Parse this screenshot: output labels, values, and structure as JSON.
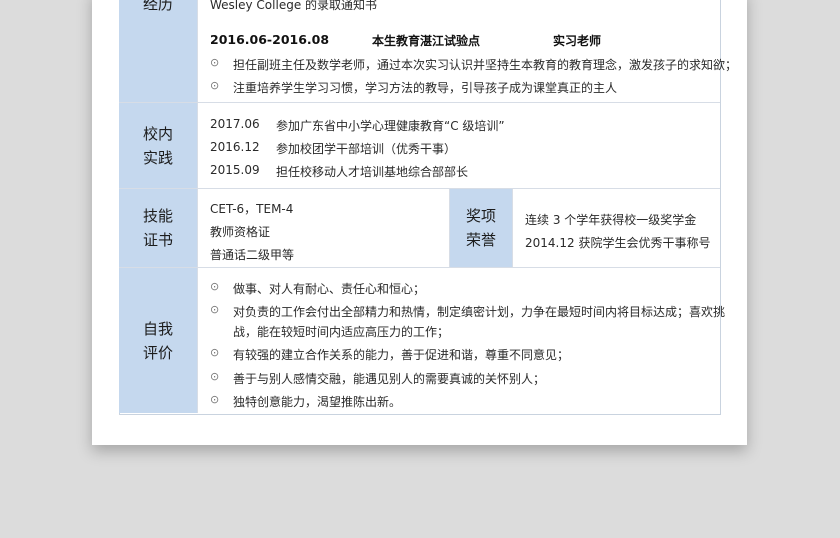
{
  "experience": {
    "label": "经历",
    "partial_line": "Wesley College 的录取通知书",
    "period": "2016.06-2016.08",
    "org": "本生教育湛江试验点",
    "role": "实习老师",
    "bullets": [
      "担任副班主任及数学老师，通过本次实习认识并坚持生本教育的教育理念，激发孩子的求知欲；",
      "注重培养学生学习习惯，学习方法的教导，引导孩子成为课堂真正的主人"
    ]
  },
  "campus": {
    "label_1": "校内",
    "label_2": "实践",
    "items": [
      {
        "date": "2017.06",
        "desc": "参加广东省中小学心理健康教育“C 级培训”"
      },
      {
        "date": "2016.12",
        "desc": "参加校团学干部培训（优秀干事）"
      },
      {
        "date": "2015.09",
        "desc": "担任校移动人才培训基地综合部部长"
      }
    ]
  },
  "skills": {
    "label_1": "技能",
    "label_2": "证书",
    "items": [
      "CET-6，TEM-4",
      "教师资格证",
      "普通话二级甲等"
    ]
  },
  "awards": {
    "label_1": "奖项",
    "label_2": "荣誉",
    "items": [
      "连续 3 个学年获得校一级奖学金",
      "2014.12 获院学生会优秀干事称号"
    ]
  },
  "self_eval": {
    "label_1": "自我",
    "label_2": "评价",
    "bullets": [
      "做事、对人有耐心、责任心和恒心；",
      "对负责的工作会付出全部精力和热情，制定缜密计划，力争在最短时间内将目标达成；喜欢挑",
      "战，能在较短时间内适应高压力的工作；",
      "有较强的建立合作关系的能力，善于促进和谐，尊重不同意见；",
      "善于与别人感情交融，能遇见别人的需要真诚的关怀别人；",
      "独特创意能力，渴望推陈出新。"
    ]
  },
  "bullet_glyph": "⊙"
}
